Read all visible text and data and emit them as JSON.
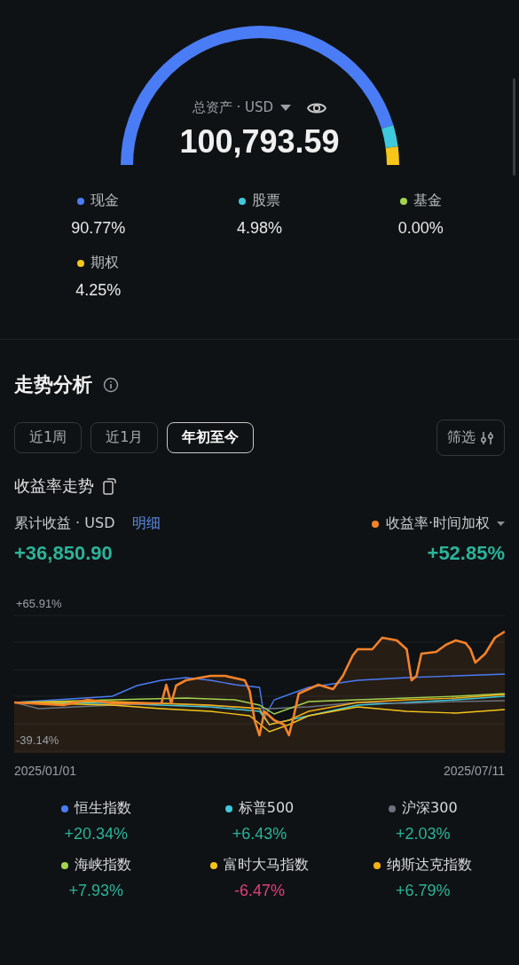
{
  "assets": {
    "label": "总资产 · USD",
    "total": "100,793.59",
    "allocation": [
      {
        "name": "现金",
        "share": "90.77%",
        "color": "#4a7cf6"
      },
      {
        "name": "股票",
        "share": "4.98%",
        "color": "#3ec9dc"
      },
      {
        "name": "基金",
        "share": "0.00%",
        "color": "#a3d44e"
      },
      {
        "name": "期权",
        "share": "4.25%",
        "color": "#f5c518"
      }
    ]
  },
  "trend": {
    "title": "走势分析",
    "periods": [
      {
        "label": "近1周",
        "selected": false
      },
      {
        "label": "近1月",
        "selected": false
      },
      {
        "label": "年初至今",
        "selected": true
      }
    ],
    "filter": "筛选",
    "subtitle": "收益率走势",
    "profit_label": "累计收益 · USD",
    "detail_link": "明细",
    "profit": "+36,850.90",
    "rate_series": {
      "label": "收益率·时间加权",
      "color": "#f5822a"
    },
    "rate": "+52.85%",
    "chart": {
      "top_label": "+65.91%",
      "bottom_label": "-39.14%",
      "start_date": "2025/01/01",
      "end_date": "2025/07/11"
    },
    "benchmarks": [
      {
        "name": "恒生指数",
        "color": "#4a7cf6",
        "change": {
          "text": "+20.34%",
          "color": "#2bb39a"
        }
      },
      {
        "name": "标普500",
        "color": "#3ec9dc",
        "change": {
          "text": "+6.43%",
          "color": "#2bb39a"
        }
      },
      {
        "name": "沪深300",
        "color": "#6b7280",
        "change": {
          "text": "+2.03%",
          "color": "#2bb39a"
        }
      },
      {
        "name": "海峡指数",
        "color": "#a3d44e",
        "change": {
          "text": "+7.93%",
          "color": "#2bb39a"
        }
      },
      {
        "name": "富时大马指数",
        "color": "#f5c518",
        "change": {
          "text": "-6.47%",
          "color": "#e0407a"
        }
      },
      {
        "name": "纳斯达克指数",
        "color": "#f5b014",
        "change": {
          "text": "+6.79%",
          "color": "#2bb39a"
        }
      }
    ]
  }
}
